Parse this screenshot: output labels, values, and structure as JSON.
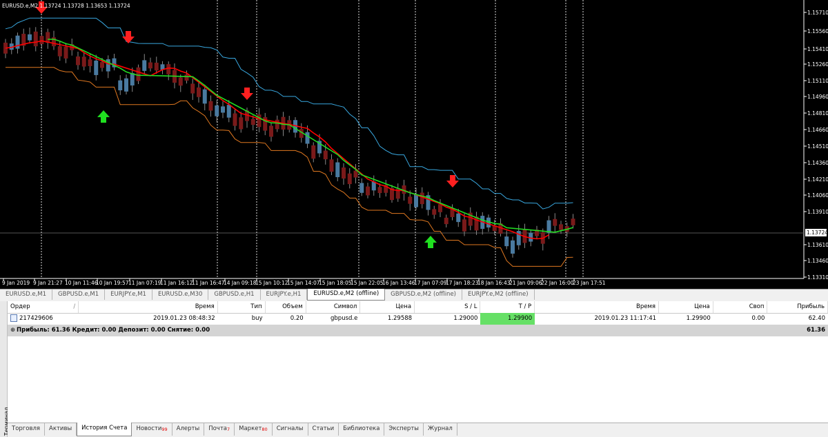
{
  "chart": {
    "title": "EURUSD.e,M2  1.13724 1.13728 1.13653 1.13724",
    "current_price": "1.13724",
    "price_axis": [
      "1.15710",
      "1.15560",
      "1.15410",
      "1.15260",
      "1.15110",
      "1.14960",
      "1.14810",
      "1.14660",
      "1.14510",
      "1.14360",
      "1.14210",
      "1.14060",
      "1.13910",
      "1.13610",
      "1.13460",
      "1.13310"
    ],
    "time_axis": [
      "9 Jan 2019",
      "9 Jan 21:27",
      "10 Jan 11:46",
      "10 Jan 19:57",
      "11 Jan 07:19",
      "11 Jan 16:12",
      "11 Jan 16:47",
      "14 Jan 09:18",
      "15 Jan 10:12",
      "15 Jan 14:07",
      "15 Jan 18:05",
      "15 Jan 22:05",
      "16 Jan 13:46",
      "17 Jan 07:09",
      "17 Jan 18:23",
      "18 Jan 16:43",
      "21 Jan 09:06",
      "22 Jan 16:00",
      "23 Jan 17:51"
    ],
    "colors": {
      "background": "#000000",
      "bull_candle": "#4a7aa0",
      "bear_candle": "#7a1a1a",
      "upper_band": "#39a8e0",
      "lower_band": "#e07820",
      "signal_red": "#ff2020",
      "signal_green": "#20e020",
      "mid_red": "#ff0000",
      "mid_green": "#22dd22"
    },
    "arrows": [
      {
        "dir": "down",
        "time": "9 Jan 21:27"
      },
      {
        "dir": "down",
        "time": "11 Jan 07:19"
      },
      {
        "dir": "up",
        "time": "10 Jan 19:57"
      },
      {
        "dir": "down",
        "time": "14 Jan 09:18"
      },
      {
        "dir": "down",
        "time": "17 Jan 18:23"
      },
      {
        "dir": "up",
        "time": "17 Jan 07:09"
      }
    ]
  },
  "chart_tabs": [
    {
      "label": "EURUSD.e,M1"
    },
    {
      "label": "GBPUSD.e,M1"
    },
    {
      "label": "EURJPY.e,M1"
    },
    {
      "label": "EURUSD.e,M30"
    },
    {
      "label": "GBPUSD.e,H1"
    },
    {
      "label": "EURJPY.e,H1"
    },
    {
      "label": "EURUSD.e,M2 (offline)",
      "active": true
    },
    {
      "label": "GBPUSD.e,M2 (offline)"
    },
    {
      "label": "EURJPY.e,M2 (offline)"
    }
  ],
  "terminal": {
    "side_label": "Терминал",
    "columns": [
      "Ордер",
      "/",
      "Время",
      "Тип",
      "Объем",
      "Символ",
      "Цена",
      "S / L",
      "T / P",
      "Время",
      "Цена",
      "Своп",
      "Прибыль"
    ],
    "deal": {
      "order": "217429606",
      "open_time": "2019.01.23 08:48:32",
      "type": "buy",
      "volume": "0.20",
      "symbol": "gbpusd.e",
      "open_price": "1.29588",
      "sl": "1.29000",
      "tp": "1.29900",
      "close_time": "2019.01.23 11:17:41",
      "close_price": "1.29900",
      "swap": "0.00",
      "profit": "62.40"
    },
    "summary": {
      "text": "Прибыль: 61.36  Кредит: 0.00  Депозит: 0.00  Снятие: 0.00",
      "total": "61.36"
    }
  },
  "bottom_tabs": [
    {
      "label": "Торговля"
    },
    {
      "label": "Активы"
    },
    {
      "label": "История Счета",
      "active": true
    },
    {
      "label": "Новости",
      "badge": "99"
    },
    {
      "label": "Алерты"
    },
    {
      "label": "Почта",
      "badge": "7"
    },
    {
      "label": "Маркет",
      "badge": "80"
    },
    {
      "label": "Сигналы"
    },
    {
      "label": "Статьи"
    },
    {
      "label": "Библиотека"
    },
    {
      "label": "Эксперты"
    },
    {
      "label": "Журнал"
    }
  ]
}
